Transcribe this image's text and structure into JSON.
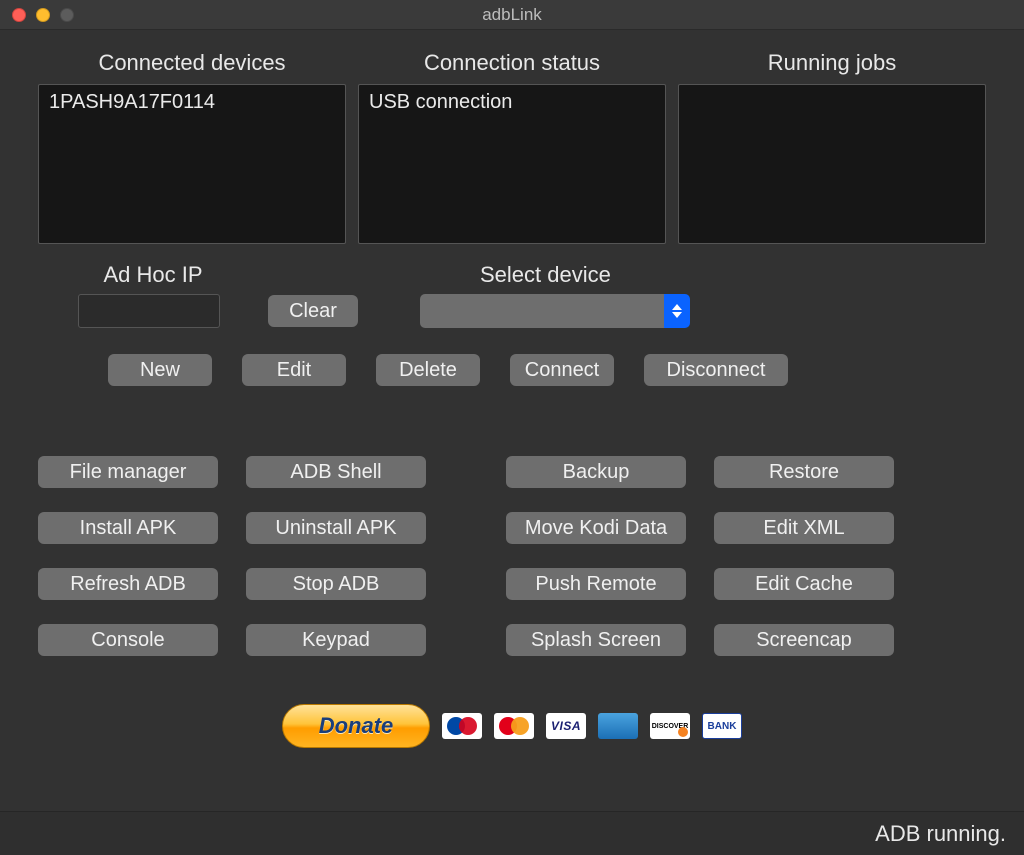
{
  "window": {
    "title": "adbLink"
  },
  "panels": {
    "connected_label": "Connected devices",
    "connected_items": [
      "1PASH9A17F0114"
    ],
    "status_label": "Connection status",
    "status_items": [
      "USB connection"
    ],
    "jobs_label": "Running jobs",
    "jobs_items": []
  },
  "adhoc": {
    "label": "Ad Hoc IP",
    "value": "",
    "clear": "Clear"
  },
  "select_device": {
    "label": "Select device",
    "selected": ""
  },
  "device_buttons": {
    "new": "New",
    "edit": "Edit",
    "delete": "Delete",
    "connect": "Connect",
    "disconnect": "Disconnect"
  },
  "tools_left": [
    "File manager",
    "ADB Shell",
    "Install APK",
    "Uninstall APK",
    "Refresh ADB",
    "Stop ADB",
    "Console",
    "Keypad"
  ],
  "tools_right": [
    "Backup",
    "Restore",
    "Move Kodi Data",
    "Edit XML",
    "Push Remote",
    "Edit Cache",
    "Splash Screen",
    "Screencap"
  ],
  "donate": {
    "label": "Donate"
  },
  "payment_cards": [
    "Maestro",
    "MasterCard",
    "VISA",
    "AmEx",
    "Discover",
    "Bank"
  ],
  "status_bar": "ADB running."
}
